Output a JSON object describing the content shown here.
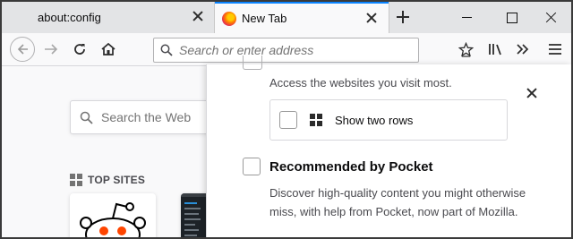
{
  "tabs": [
    {
      "label": "about:config",
      "active": false
    },
    {
      "label": "New Tab",
      "active": true
    }
  ],
  "toolbar": {
    "url_placeholder": "Search or enter address"
  },
  "content": {
    "search_placeholder": "Search the Web",
    "top_sites_label": "TOP SITES"
  },
  "panel": {
    "top_sites_description": "Access the websites you visit most.",
    "show_two_rows_label": "Show two rows",
    "show_two_rows_checked": false,
    "pocket_label": "Recommended by Pocket",
    "pocket_checked": false,
    "pocket_description": "Discover high-quality content you might otherwise miss, with help from Pocket, now part of Mozilla."
  },
  "colors": {
    "accent": "#0a84ff",
    "tabstrip": "#e3e4e6",
    "reddit": "#ff4500"
  }
}
